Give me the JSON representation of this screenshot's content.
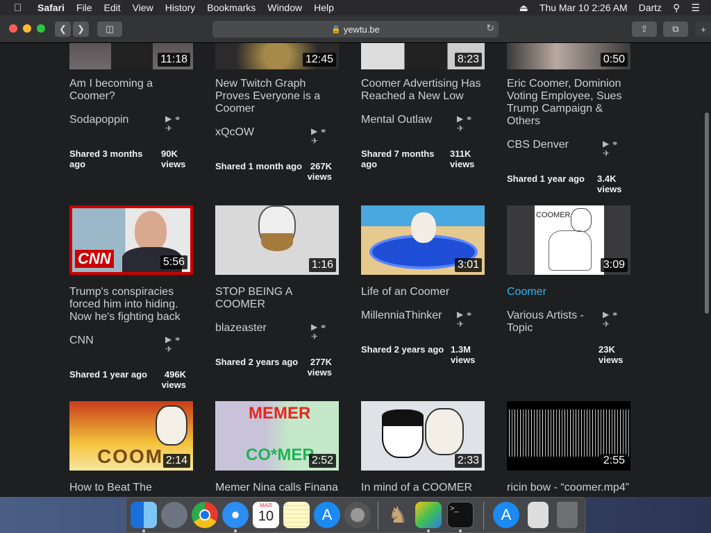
{
  "menubar": {
    "items": [
      "Safari",
      "File",
      "Edit",
      "View",
      "History",
      "Bookmarks",
      "Window",
      "Help"
    ],
    "datetime": "Thu Mar 10  2:26 AM",
    "user": "Dartz"
  },
  "toolbar": {
    "url": "yewtu.be"
  },
  "videos": [
    {
      "title": "Am I becoming a Coomer?",
      "channel": "Sodapoppin",
      "shared": "Shared 3 months ago",
      "views": "90K views",
      "duration": "11:18"
    },
    {
      "title": "New Twitch Graph Proves Everyone is a Coomer",
      "channel": "xQcOW",
      "shared": "Shared 1 month ago",
      "views": "267K views",
      "duration": "12:45"
    },
    {
      "title": "Coomer Advertising Has Reached a New Low",
      "channel": "Mental Outlaw",
      "shared": "Shared 7 months ago",
      "views": "311K views",
      "duration": "8:23"
    },
    {
      "title": "Eric Coomer, Dominion Voting Employee, Sues Trump Campaign & Others",
      "channel": "CBS Denver",
      "shared": "Shared 1 year ago",
      "views": "3.4K views",
      "duration": "0:50"
    },
    {
      "title": "Trump's conspiracies forced him into hiding. Now he's fighting back",
      "channel": "CNN",
      "shared": "Shared 1 year ago",
      "views": "496K views",
      "duration": "5:56"
    },
    {
      "title": "STOP BEING A COOMER",
      "channel": "blazeaster",
      "shared": "Shared 2 years ago",
      "views": "277K views",
      "duration": "1:16"
    },
    {
      "title": "Life of an Coomer",
      "channel": "MillenniaThinker",
      "shared": "Shared 2 years ago",
      "views": "1.3M views",
      "duration": "3:01"
    },
    {
      "title": "Coomer",
      "channel": "Various Artists - Topic",
      "shared": "",
      "views": "23K views",
      "duration": "3:09"
    },
    {
      "title": "How to Beat The",
      "duration": "2:14"
    },
    {
      "title": "Memer Nina calls Finana",
      "duration": "2:52"
    },
    {
      "title": "In mind of a COOMER",
      "duration": "2:33"
    },
    {
      "title": "ricin bow - “coomer.mp4”",
      "duration": "2:55"
    }
  ],
  "thumb_text": {
    "cnn": "CNN",
    "memer": "MEMER",
    "comer": "CO*MER",
    "coom": "COOM",
    "coomer_sheet": "COOMER"
  },
  "icons": {
    "video": "youtube-icon",
    "audio": "headphones-icon",
    "mode": "airplane-icon"
  },
  "dock": {
    "items": [
      "Finder",
      "Launchpad",
      "Chrome",
      "Safari",
      "Calendar",
      "Notes",
      "App Store",
      "System Preferences",
      "Chess",
      "BlueStacks",
      "Terminal",
      "App Store",
      "File",
      "Trash"
    ],
    "calendar_month": "MAR",
    "calendar_day": "10"
  },
  "colors": {
    "link": "#2fb6ec",
    "cnn_red": "#cc0000"
  }
}
